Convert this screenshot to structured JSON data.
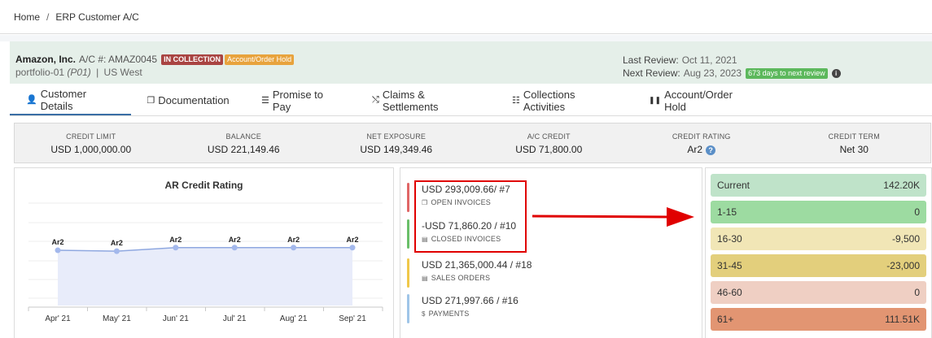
{
  "breadcrumb": {
    "home": "Home",
    "sep": "/",
    "current": "ERP Customer A/C"
  },
  "account": {
    "name": "Amazon, Inc.",
    "acno_label": "A/C #: AMAZ0045",
    "badge_collection": "IN COLLECTION",
    "badge_hold": "Account/Order Hold",
    "portfolio": "portfolio-01",
    "portfolio_code": "(P01)",
    "separator": "|",
    "region": "US West",
    "last_review_label": "Last Review:",
    "last_review": "Oct 11, 2021",
    "next_review_label": "Next Review:",
    "next_review": "Aug 23, 2023",
    "days_badge": "673 days to next review"
  },
  "tabs": [
    {
      "label": "Customer Details",
      "icon": "user-icon",
      "glyph": "👤"
    },
    {
      "label": "Documentation",
      "icon": "copy-icon",
      "glyph": "❐"
    },
    {
      "label": "Promise to Pay",
      "icon": "list-icon",
      "glyph": "☰"
    },
    {
      "label": "Claims & Settlements",
      "icon": "shuffle-icon",
      "glyph": "⤭"
    },
    {
      "label": "Collections Activities",
      "icon": "checklist-icon",
      "glyph": "☷"
    },
    {
      "label": "Account/Order Hold",
      "icon": "pause-icon",
      "glyph": "❚❚"
    }
  ],
  "summary": [
    {
      "label": "CREDIT LIMIT",
      "value": "USD 1,000,000.00"
    },
    {
      "label": "BALANCE",
      "value": "USD 221,149.46"
    },
    {
      "label": "NET EXPOSURE",
      "value": "USD 149,349.46"
    },
    {
      "label": "A/C CREDIT",
      "value": "USD 71,800.00"
    },
    {
      "label": "CREDIT RATING",
      "value": "Ar2"
    },
    {
      "label": "CREDIT TERM",
      "value": "Net 30"
    }
  ],
  "chart_data": {
    "type": "area",
    "title": "AR Credit Rating",
    "categories": [
      "Apr' 21",
      "May' 21",
      "Jun' 21",
      "Jul' 21",
      "Aug' 21",
      "Sep' 21"
    ],
    "series": [
      {
        "values": [
          2.05,
          2.0,
          2.2,
          2.2,
          2.2,
          2.2
        ],
        "labels": [
          "Ar2",
          "Ar2",
          "Ar2",
          "Ar2",
          "Ar2",
          "Ar2"
        ]
      }
    ],
    "grid": true,
    "colors": {
      "line": "#8fa8e0",
      "fill": "#e8ecfa",
      "point": "#a3b8ec"
    }
  },
  "invoices": [
    {
      "amount": "USD 293,009.66/ #7",
      "label": "OPEN INVOICES",
      "icon": "copy-icon",
      "color": "#e06666"
    },
    {
      "amount": "-USD 71,860.20 / #10",
      "label": "CLOSED INVOICES",
      "icon": "file-icon",
      "color": "#6abf69"
    },
    {
      "amount": "USD 21,365,000.44 / #18",
      "label": "SALES ORDERS",
      "icon": "file-icon",
      "color": "#f0c84a"
    },
    {
      "amount": "USD 271,997.66 / #16",
      "label": "PAYMENTS",
      "icon": "dollar-icon",
      "color": "#9fc5e8"
    }
  ],
  "aging": [
    {
      "label": "Current",
      "value": "142.20K",
      "color": "#bfe3c9"
    },
    {
      "label": "1-15",
      "value": "0",
      "color": "#9ddba1"
    },
    {
      "label": "16-30",
      "value": "-9,500",
      "color": "#f1e6b6"
    },
    {
      "label": "31-45",
      "value": "-23,000",
      "color": "#e3cf7c"
    },
    {
      "label": "46-60",
      "value": "0",
      "color": "#efcfc3"
    },
    {
      "label": "61+",
      "value": "111.51K",
      "color": "#e29572"
    }
  ]
}
